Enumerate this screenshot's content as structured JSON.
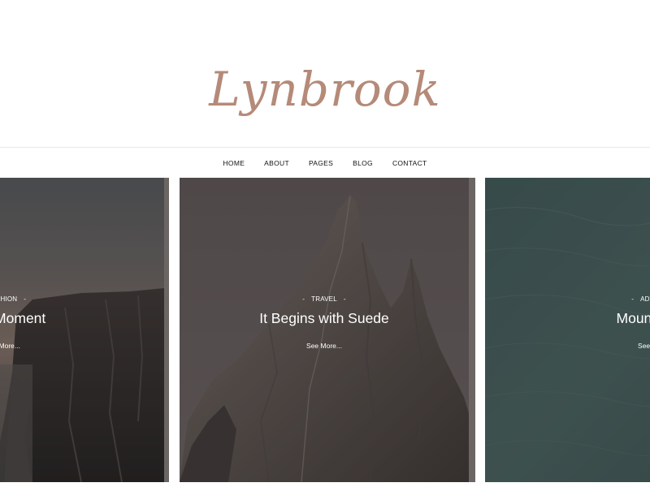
{
  "site": {
    "logo_text": "Lynbrook"
  },
  "nav": {
    "items": [
      {
        "label": "HOME"
      },
      {
        "label": "ABOUT"
      },
      {
        "label": "PAGES"
      },
      {
        "label": "BLOG"
      },
      {
        "label": "CONTACT"
      }
    ]
  },
  "slider": {
    "cards": [
      {
        "category": "FASHION",
        "title": "Miu Moment",
        "more": "See More..."
      },
      {
        "category": "TRAVEL",
        "title": "It Begins with Suede",
        "more": "See More..."
      },
      {
        "category": "ADVENTURES",
        "title": "Mountain Va",
        "more": "See More..."
      }
    ],
    "dash": "-"
  },
  "colors": {
    "logo": "#b58a78",
    "nav_text": "#111111",
    "card_text": "#ffffff"
  }
}
